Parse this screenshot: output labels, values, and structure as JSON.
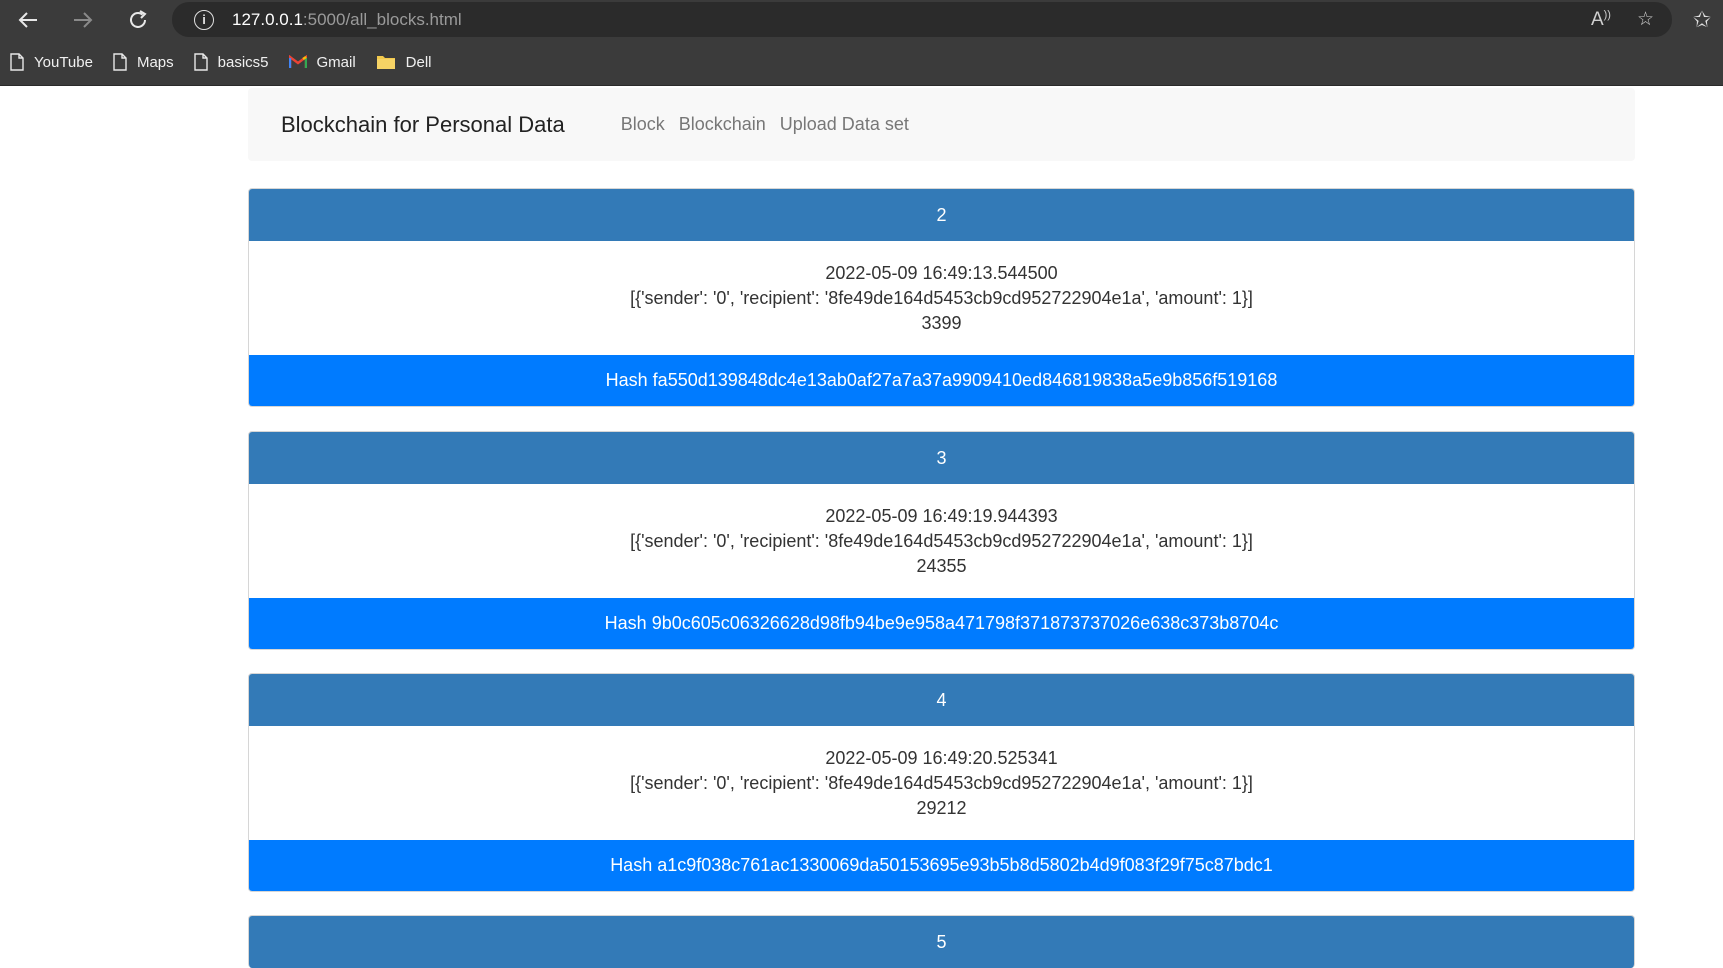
{
  "browser": {
    "url_host": "127.0.0.1",
    "url_path": ":5000/all_blocks.html",
    "bookmarks": [
      {
        "label": "YouTube",
        "icon": "page-icon"
      },
      {
        "label": "Maps",
        "icon": "page-icon"
      },
      {
        "label": "basics5",
        "icon": "page-icon"
      },
      {
        "label": "Gmail",
        "icon": "gmail-icon"
      },
      {
        "label": "Dell",
        "icon": "folder-icon"
      }
    ]
  },
  "navbar": {
    "brand": "Blockchain for Personal Data",
    "links": [
      "Block",
      "Blockchain",
      "Upload Data set"
    ]
  },
  "blocks": [
    {
      "index": "2",
      "timestamp": "2022-05-09 16:49:13.544500",
      "transactions": "[{'sender': '0', 'recipient': '8fe49de164d5453cb9cd952722904e1a', 'amount': 1}]",
      "proof": "3399",
      "hash": "Hash fa550d139848dc4e13ab0af27a7a37a9909410ed846819838a5e9b856f519168"
    },
    {
      "index": "3",
      "timestamp": "2022-05-09 16:49:19.944393",
      "transactions": "[{'sender': '0', 'recipient': '8fe49de164d5453cb9cd952722904e1a', 'amount': 1}]",
      "proof": "24355",
      "hash": "Hash 9b0c605c06326628d98fb94be9e958a471798f371873737026e638c373b8704c"
    },
    {
      "index": "4",
      "timestamp": "2022-05-09 16:49:20.525341",
      "transactions": "[{'sender': '0', 'recipient': '8fe49de164d5453cb9cd952722904e1a', 'amount': 1}]",
      "proof": "29212",
      "hash": "Hash a1c9f038c761ac1330069da50153695e93b5b8d5802b4d9f083f29f75c87bdc1"
    },
    {
      "index": "5"
    }
  ],
  "colors": {
    "header": "#337ab7",
    "footer": "#007bff"
  }
}
